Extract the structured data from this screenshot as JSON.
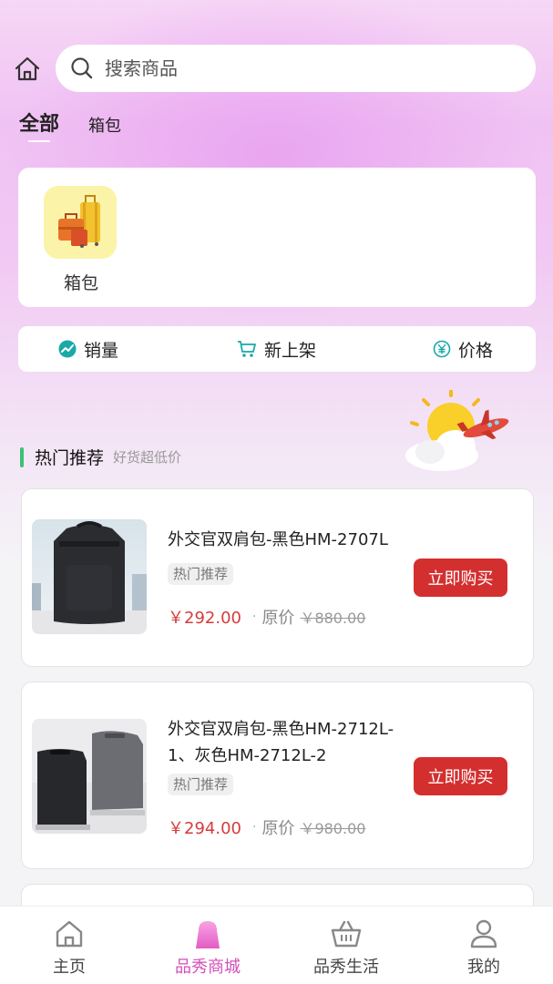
{
  "search": {
    "placeholder": "搜索商品"
  },
  "tabs": [
    {
      "label": "全部",
      "active": true
    },
    {
      "label": "箱包",
      "active": false
    }
  ],
  "categories": [
    {
      "label": "箱包",
      "icon": "luggage-icon"
    }
  ],
  "sort": [
    {
      "label": "销量",
      "icon": "trend-icon"
    },
    {
      "label": "新上架",
      "icon": "cart-icon"
    },
    {
      "label": "价格",
      "icon": "yen-coin-icon"
    }
  ],
  "section": {
    "title": "热门推荐",
    "subtitle": "好货超低价"
  },
  "products": [
    {
      "name": "外交官双肩包-黑色HM-2707L",
      "tag": "热门推荐",
      "price": "￥292.00",
      "orig_label": "原价",
      "orig_price": "￥880.00",
      "buy_label": "立即购买"
    },
    {
      "name": "外交官双肩包-黑色HM-2712L-1、灰色HM-2712L-2",
      "tag": "热门推荐",
      "price": "￥294.00",
      "orig_label": "原价",
      "orig_price": "￥980.00",
      "buy_label": "立即购买"
    }
  ],
  "nav": [
    {
      "label": "主页",
      "icon": "home-icon",
      "active": false
    },
    {
      "label": "品秀商城",
      "icon": "mall-bag-icon",
      "active": true
    },
    {
      "label": "品秀生活",
      "icon": "basket-icon",
      "active": false
    },
    {
      "label": "我的",
      "icon": "user-icon",
      "active": false
    }
  ],
  "colors": {
    "accent": "#d42f2f",
    "nav_active": "#d44fb8",
    "section_bar": "#3bc270",
    "sort_icon": "#1ba8a8"
  }
}
